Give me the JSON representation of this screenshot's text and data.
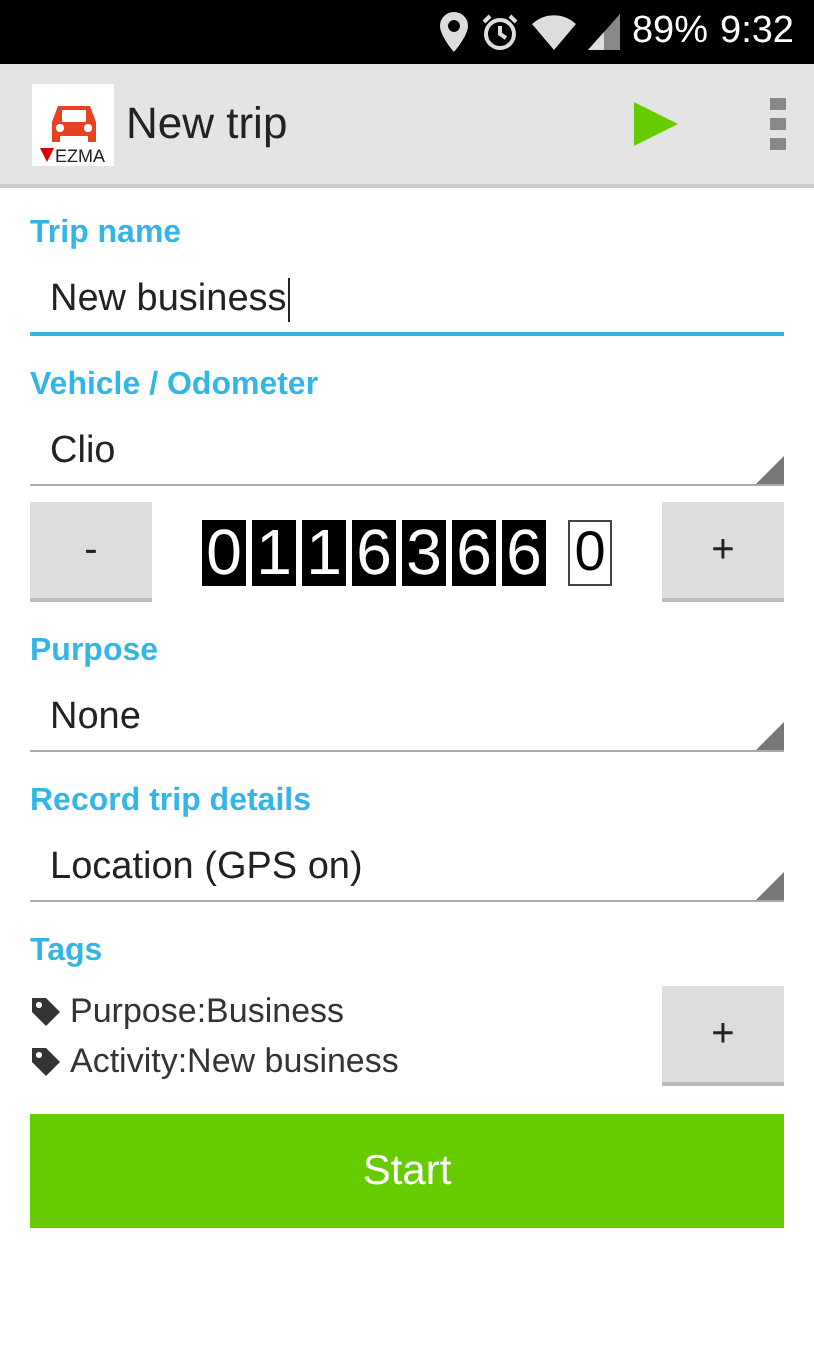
{
  "status_bar": {
    "battery": "89%",
    "time": "9:32"
  },
  "action_bar": {
    "logo_text": "EZMA",
    "title": "New trip"
  },
  "trip_name": {
    "label": "Trip name",
    "value": "New business"
  },
  "vehicle": {
    "label": "Vehicle / Odometer",
    "value": "Clio"
  },
  "odometer": {
    "minus": "-",
    "plus": "+",
    "digits": [
      {
        "digit": "0",
        "kind": "fixed"
      },
      {
        "digit": "1",
        "kind": "fixed"
      },
      {
        "digit": "1",
        "kind": "fixed"
      },
      {
        "digit": "6",
        "kind": "fixed"
      },
      {
        "digit": "3",
        "kind": "fixed"
      },
      {
        "digit": "6",
        "kind": "fixed"
      },
      {
        "digit": "6",
        "kind": "fixed"
      },
      {
        "digit": "0",
        "kind": "decimal"
      }
    ]
  },
  "purpose": {
    "label": "Purpose",
    "value": "None"
  },
  "record": {
    "label": "Record trip details",
    "value": "Location (GPS on)"
  },
  "tags": {
    "label": "Tags",
    "items": [
      "Purpose:Business",
      "Activity:New business"
    ],
    "add": "+"
  },
  "start_button": "Start"
}
